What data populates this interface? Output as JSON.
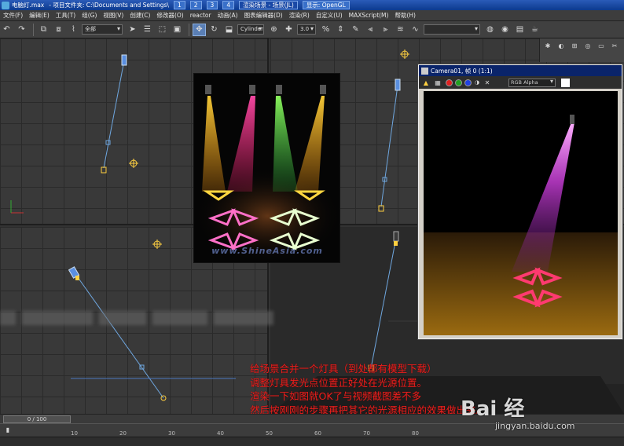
{
  "titlebar": {
    "file": "电脑灯.max",
    "project": "- 项目文件夹: C:\\Documents and Settings\\",
    "task_buttons": [
      "1",
      "2",
      "3",
      "4",
      "渲染场景 - 场景(JL)",
      "显示: OpenGL"
    ]
  },
  "menu": [
    "文件(F)",
    "编辑(E)",
    "工具(T)",
    "组(G)",
    "视图(V)",
    "创建(C)",
    "修改器(O)",
    "reactor",
    "动画(A)",
    "图表编辑器(D)",
    "渲染(R)",
    "自定义(U)",
    "MAXScript(M)",
    "帮助(H)"
  ],
  "toolbar": {
    "selection_filter": "全部",
    "primitive": "Cylinder",
    "spinner": "3.0"
  },
  "render_photo": {
    "watermark": "www.ShineAsia.com"
  },
  "camera_window": {
    "title": "Camera01, 帧 0 (1:1)",
    "channel": "RGB Alpha",
    "colors": {
      "red": "#e02020",
      "green": "#20a020",
      "blue": "#2040e0"
    }
  },
  "notes": [
    "给场景合并一个灯具（到处都有模型下载）",
    "调整灯具发光点位置正好处在光源位置。",
    "渲染一下如图就OK了与视频截图差不多",
    "然后按刚刚的步骤再把其它的光源相应的效果做出来。"
  ],
  "timeline": {
    "slider_label": "0 / 100",
    "ticks": [
      "10",
      "20",
      "30",
      "40",
      "50",
      "60",
      "70",
      "80"
    ]
  },
  "watermark": {
    "brand": "Bai 经",
    "url": "jingyan.baidu.com"
  }
}
